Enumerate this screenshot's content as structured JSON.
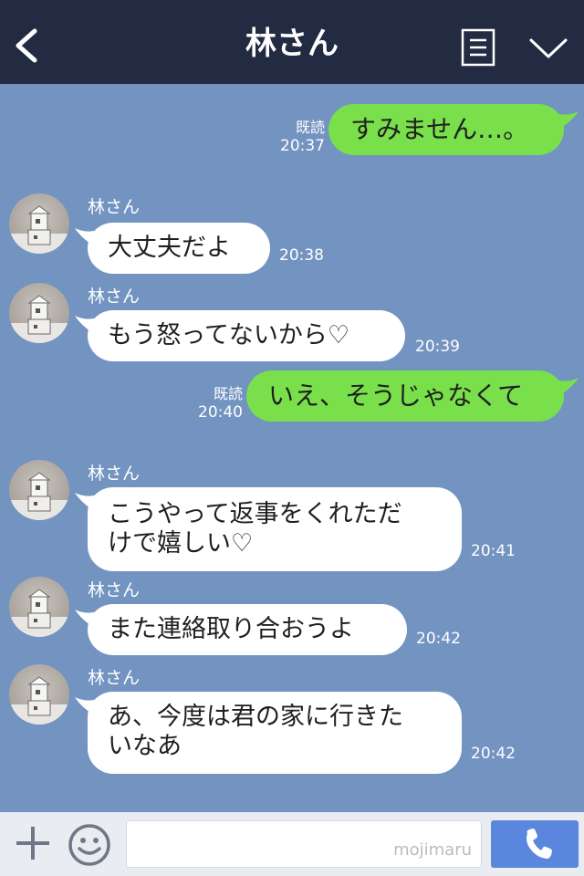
{
  "header": {
    "title": "林さん"
  },
  "messages": [
    {
      "type": "sent",
      "text": "すみません…。",
      "read_label": "既読",
      "time": "20:37"
    },
    {
      "type": "received",
      "sender": "林さん",
      "lines": [
        "大丈夫だよ"
      ],
      "time": "20:38"
    },
    {
      "type": "received",
      "sender": "林さん",
      "lines": [
        "もう怒ってないから♡"
      ],
      "time": "20:39"
    },
    {
      "type": "sent",
      "text": "いえ、そうじゃなくて",
      "read_label": "既読",
      "time": "20:40"
    },
    {
      "type": "received",
      "sender": "林さん",
      "lines": [
        "こうやって返事をくれただ",
        "けで嬉しい♡"
      ],
      "time": "20:41"
    },
    {
      "type": "received",
      "sender": "林さん",
      "lines": [
        "また連絡取り合おうよ"
      ],
      "time": "20:42"
    },
    {
      "type": "received",
      "sender": "林さん",
      "lines": [
        "あ、今度は君の家に行きた",
        "いなあ"
      ],
      "time": "20:42"
    }
  ],
  "footer": {
    "input_value": "",
    "watermark": "mojimaru"
  },
  "colors": {
    "header_bg": "#232b42",
    "chat_bg": "#7393c1",
    "sent_bubble": "#79e04b",
    "received_bubble": "#ffffff",
    "call_button": "#5a86dd"
  },
  "icons": [
    "back-arrow-icon",
    "menu-list-icon",
    "chevron-down-icon",
    "plus-icon",
    "emoji-icon",
    "phone-icon",
    "avatar-image"
  ]
}
